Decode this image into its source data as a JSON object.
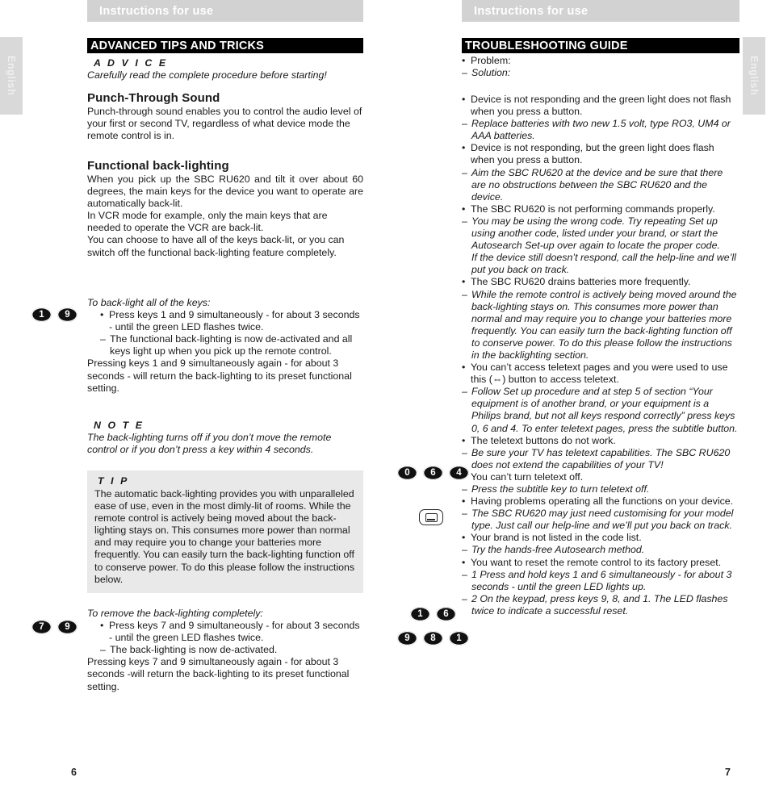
{
  "document": {
    "running_header_left": "Instructions for use",
    "running_header_right": "Instructions for use",
    "language_tab_left": "English",
    "language_tab_right": "English",
    "page_number_left": "6",
    "page_number_right": "7"
  },
  "left_page": {
    "banner_title": "ADVANCED TIPS AND TRICKS",
    "advice_kicker": "A D V I C E",
    "advice_text": "Carefully read the complete procedure before starting!",
    "section1": {
      "heading": "Punch-Through Sound",
      "body": "Punch-through sound enables you to control the audio level of your first or second TV, regardless of what device mode the remote control is in."
    },
    "section2": {
      "heading": "Functional back-lighting",
      "para1": "When you pick up the SBC RU620 and tilt it over about 60 degrees, the main keys for the device you want to operate are automatically back-lit.",
      "para2": "In VCR mode for example, only the main keys that are needed to operate the VCR are back-lit.",
      "para3": "You can choose to have all of the keys back-lit, or you can switch off the functional back-lighting feature completely."
    },
    "backlight_all": {
      "keys": [
        "1",
        "9"
      ],
      "intro": "To back-light all of the keys:",
      "bullet": "Press keys 1 and 9 simultaneously - for about 3 seconds - until the green LED flashes twice.",
      "dash": "The functional back-lighting is now de-activated and all keys light up when you pick up the remote control.",
      "closing": "Pressing keys 1 and 9 simultaneously again - for about 3 seconds - will return the back-lighting to its preset functional setting."
    },
    "note": {
      "kicker": "N O T E",
      "text": "The back-lighting turns off if you don’t move the remote control or if you don’t press a key within 4 seconds."
    },
    "tip": {
      "kicker": "T I P",
      "text": "The automatic back-lighting provides you with unparalleled ease of use, even in the most dimly-lit of rooms. While the remote control is actively being moved about the back-lighting stays on. This consumes more power than normal and may require you to change your batteries more frequently. You can easily turn the back-lighting function off to conserve power. To do this please follow the instructions below."
    },
    "backlight_remove": {
      "keys": [
        "7",
        "9"
      ],
      "intro": "To remove the back-lighting completely:",
      "bullet": "Press keys 7 and 9 simultaneously - for about 3 seconds - until the green LED flashes twice.",
      "dash": "The back-lighting is now de-activated.",
      "closing": "Pressing keys 7 and 9 simultaneously again - for about 3 seconds -will return the back-lighting to its preset functional setting."
    }
  },
  "right_page": {
    "banner_title": "TROUBLESHOOTING GUIDE",
    "legend": {
      "problem": "Problem:",
      "solution": "Solution:"
    },
    "entries": [
      {
        "problem": "Device is not responding and the green light does not flash when you press a button.",
        "solutions": [
          "Replace batteries with two new 1.5 volt, type RO3, UM4 or AAA batteries."
        ]
      },
      {
        "problem": "Device is not responding, but the green light does flash when you press a button.",
        "solutions": [
          "Aim the SBC RU620 at the device and be sure that there are no obstructions between the SBC RU620 and the device."
        ]
      },
      {
        "problem": "The SBC RU620 is not performing commands properly.",
        "solutions": [
          "You may be using the wrong code. Try repeating Set up using another code, listed under your brand, or start the Autosearch Set-up over again to locate the proper code."
        ],
        "solution_extra": "If the device still doesn’t respond, call the help-line and we’ll put you back on track."
      },
      {
        "problem": "The SBC RU620 drains batteries more frequently.",
        "solutions": [
          "While the remote control is actively being moved around the back-lighting stays on. This consumes more power than normal and may require you to change your batteries more frequently. You can easily turn the back-lighting function off to conserve power. To do this please follow the instructions in the backlighting section."
        ]
      },
      {
        "problem": "You can’t access teletext pages and you were used to use this (⇔) button to access teletext.",
        "solutions": [
          "Follow Set up procedure and at step 5 of section “Your equipment is of another brand, or your equipment is a Philips brand, but not all keys respond correctly” press keys 0, 6 and 4. To enter teletext pages, press the subtitle button."
        ]
      },
      {
        "problem": "The teletext buttons do not work.",
        "solutions": [
          "Be sure your TV has teletext capabilities. The SBC RU620 does not extend the capabilities of your TV!"
        ]
      },
      {
        "problem": "You can’t turn teletext off.",
        "solutions": [
          "Press the subtitle key to turn teletext off."
        ]
      },
      {
        "problem": "Having problems operating all the functions on your device.",
        "solutions": [
          "The SBC RU620 may just need customising for your model type. Just call our help-line and we’ll put you back on track."
        ]
      },
      {
        "problem": "Your brand is not listed in the code list.",
        "solutions": [
          "Try the hands-free Autosearch method."
        ]
      },
      {
        "problem": "You want to reset the remote control to its factory preset.",
        "solutions": [
          "1 Press and hold keys 1 and 6 simultaneously - for about 3 seconds - until the green LED lights up.",
          "2 On the keypad, press keys 9, 8, and 1. The LED flashes twice to indicate a successful reset."
        ]
      }
    ],
    "key_groups": {
      "teletext_keys": [
        "0",
        "6",
        "4"
      ],
      "subtitle_button_icon": "subtitle-button-icon",
      "reset_keys_step1": [
        "1",
        "6"
      ],
      "reset_keys_step2": [
        "9",
        "8",
        "1"
      ]
    }
  },
  "markers": {
    "bullet": "•",
    "dash": "–"
  },
  "colors": {
    "banner_bg": "#000000",
    "runhead_bg": "#d2d2d2",
    "tipbox_bg": "#e9e9e9",
    "lang_tab_bg": "#d9d9d9"
  }
}
